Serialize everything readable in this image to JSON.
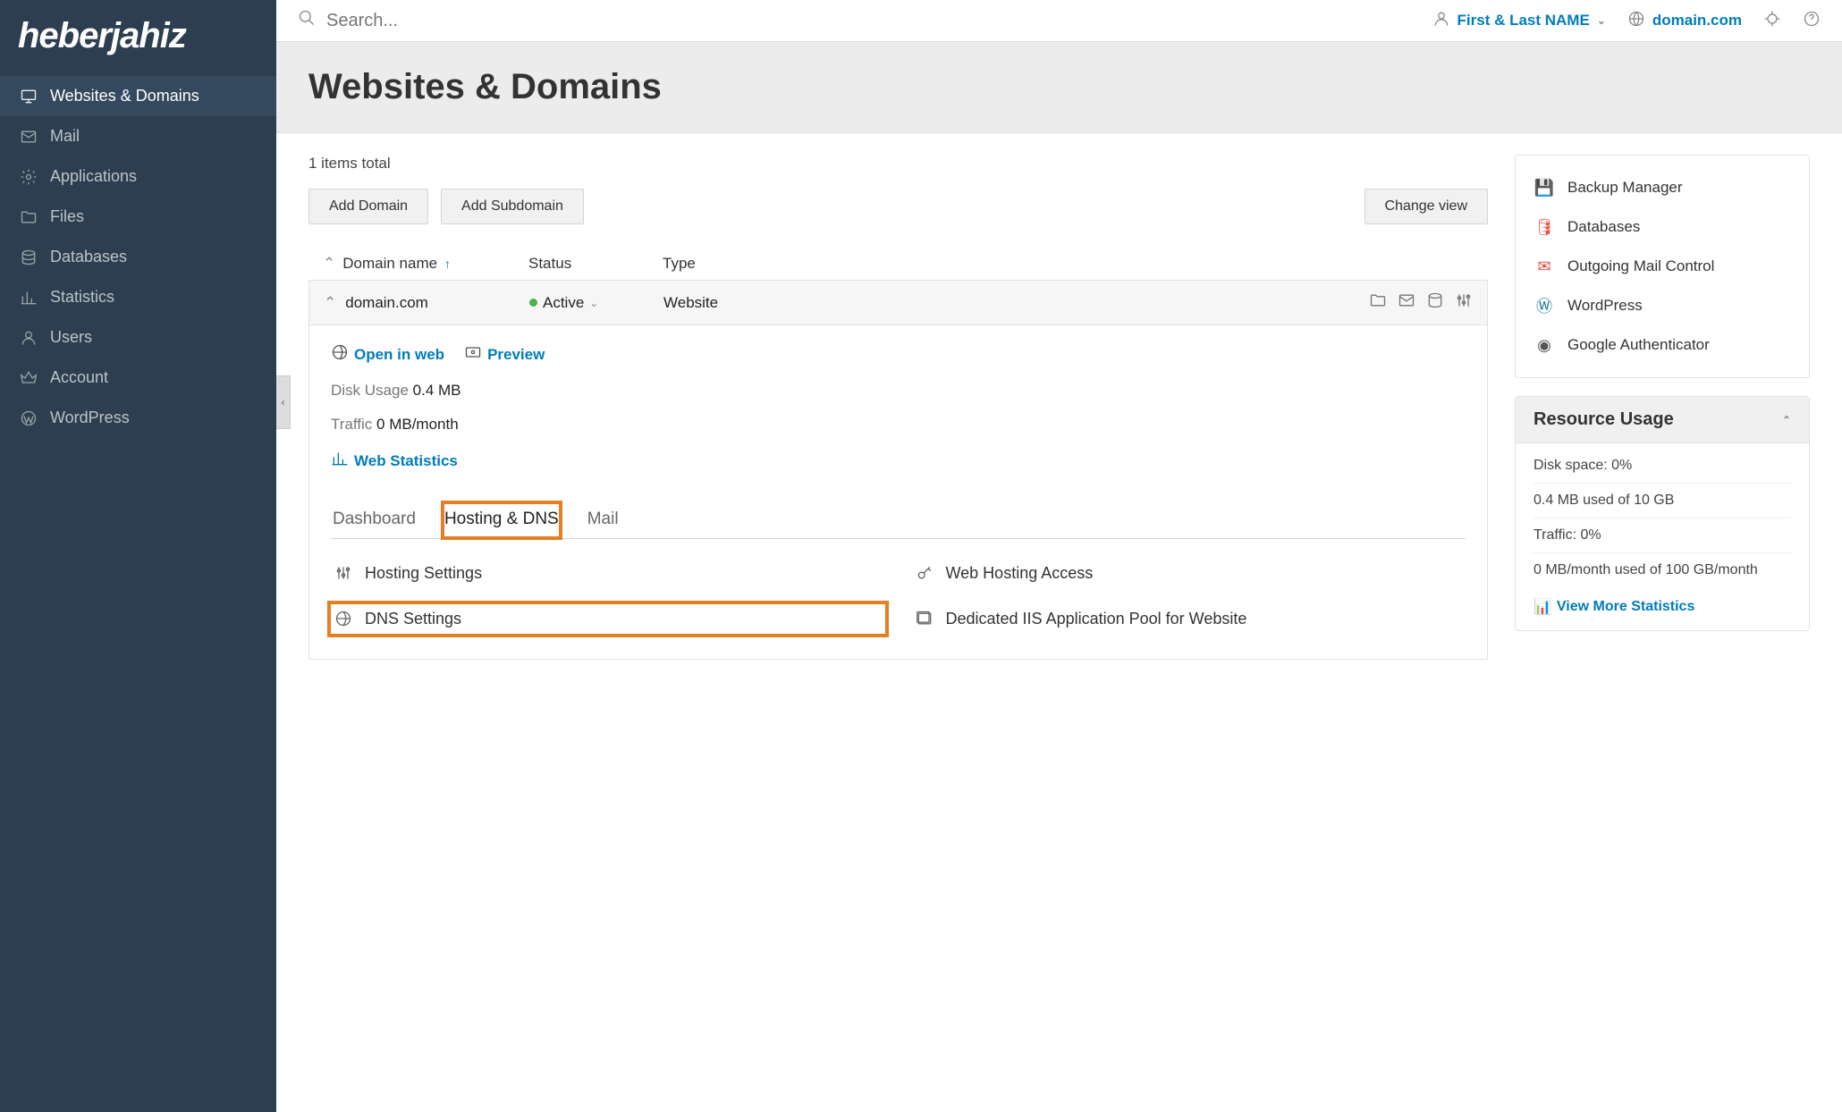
{
  "brand": {
    "name": "heberjahiz"
  },
  "topbar": {
    "search_placeholder": "Search...",
    "user_name": "First & Last NAME",
    "domain": "domain.com"
  },
  "sidebar": {
    "items": [
      {
        "label": "Websites & Domains",
        "icon": "monitor",
        "active": true
      },
      {
        "label": "Mail",
        "icon": "mail"
      },
      {
        "label": "Applications",
        "icon": "gear"
      },
      {
        "label": "Files",
        "icon": "folder"
      },
      {
        "label": "Databases",
        "icon": "stack"
      },
      {
        "label": "Statistics",
        "icon": "bars"
      },
      {
        "label": "Users",
        "icon": "user"
      },
      {
        "label": "Account",
        "icon": "crown"
      },
      {
        "label": "WordPress",
        "icon": "wp"
      }
    ]
  },
  "page": {
    "title": "Websites & Domains",
    "items_total": "1 items total",
    "buttons": {
      "add_domain": "Add Domain",
      "add_subdomain": "Add Subdomain",
      "change_view": "Change view"
    },
    "table": {
      "cols": {
        "domain": "Domain name",
        "status": "Status",
        "type": "Type"
      }
    },
    "domain": {
      "name": "domain.com",
      "status": "Active",
      "type": "Website",
      "open_in_web": "Open in web",
      "preview": "Preview",
      "disk_usage_label": "Disk Usage",
      "disk_usage_value": "0.4 MB",
      "traffic_label": "Traffic",
      "traffic_value": "0 MB/month",
      "web_stats": "Web Statistics",
      "tabs": {
        "dashboard": "Dashboard",
        "hosting": "Hosting & DNS",
        "mail": "Mail"
      },
      "settings": {
        "hosting_settings": "Hosting Settings",
        "web_hosting_access": "Web Hosting Access",
        "dns_settings": "DNS Settings",
        "dedicated_iis": "Dedicated IIS Application Pool for Website"
      }
    }
  },
  "side_tools": [
    {
      "label": "Backup Manager",
      "color": "#3498db"
    },
    {
      "label": "Databases",
      "color": "#e74c3c"
    },
    {
      "label": "Outgoing Mail Control",
      "color": "#e74c3c"
    },
    {
      "label": "WordPress",
      "color": "#21759b"
    },
    {
      "label": "Google Authenticator",
      "color": "#555"
    }
  ],
  "resource": {
    "title": "Resource Usage",
    "disk_label": "Disk space: 0%",
    "disk_detail": "0.4 MB used of 10 GB",
    "traffic_label": "Traffic: 0%",
    "traffic_detail": "0 MB/month used of 100 GB/month",
    "more": "View More Statistics"
  }
}
